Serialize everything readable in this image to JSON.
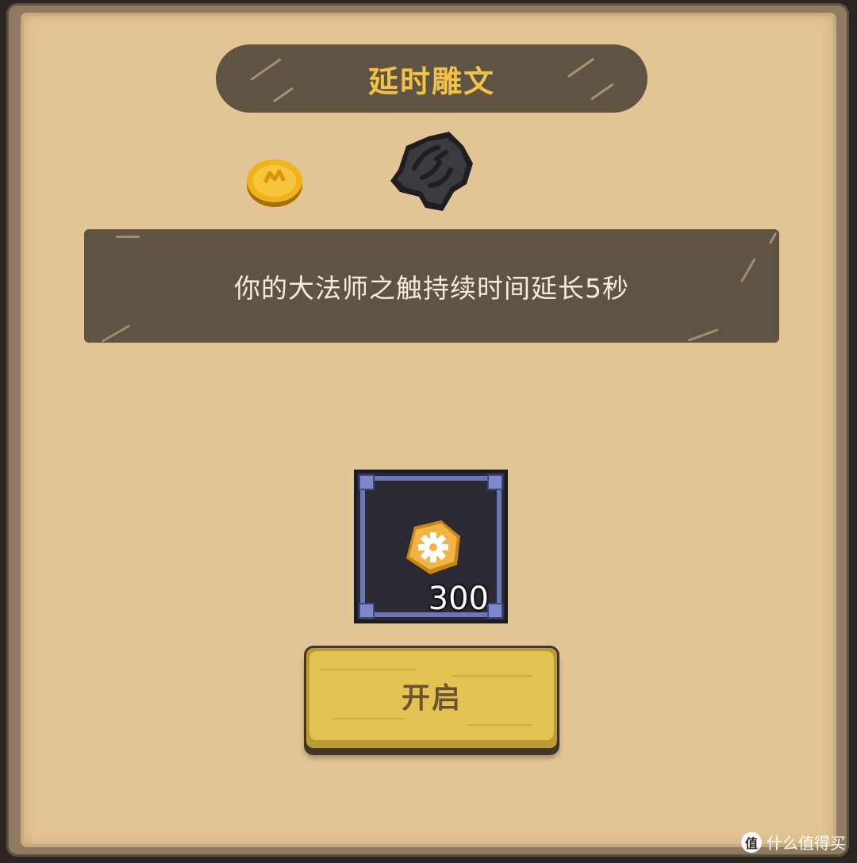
{
  "dialog": {
    "title": "延时雕文",
    "description": "你的大法师之触持续时间延长5秒"
  },
  "rewards": {
    "coin_icon": "gold-coin-icon",
    "rock_icon": "dark-rune-stone-icon"
  },
  "cost": {
    "icon": "gear-stone-icon",
    "amount": "300"
  },
  "actions": {
    "open_label": "开启"
  },
  "watermark": {
    "logo_char": "值",
    "text": "什么值得买"
  },
  "colors": {
    "panel_bg": "#e3c495",
    "banner_bg": "#5f5444",
    "title_text": "#f2c14a",
    "slot_border": "#6a78b8",
    "button_face": "#e2c253"
  }
}
